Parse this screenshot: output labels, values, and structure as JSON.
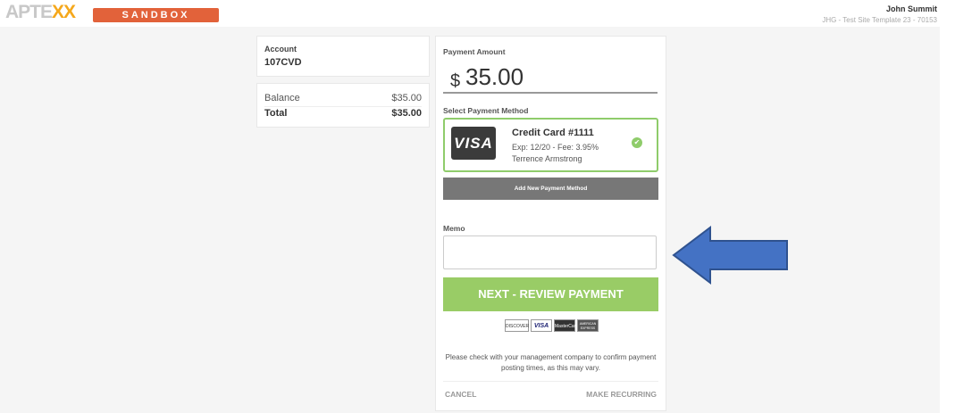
{
  "brand": {
    "logo_main": "APTE",
    "logo_accent": "XX",
    "env_badge": "SANDBOX"
  },
  "user": {
    "name": "John Summit",
    "site": "JHG - Test Site Template 23 - 70153"
  },
  "account": {
    "label": "Account",
    "value": "107CVD"
  },
  "balance": {
    "rows": [
      {
        "label": "Balance",
        "amount": "$35.00"
      },
      {
        "label": "Total",
        "amount": "$35.00"
      }
    ]
  },
  "payment": {
    "amount_label": "Payment Amount",
    "currency_symbol": "$",
    "amount": "35.00",
    "method_label": "Select Payment Method",
    "card": {
      "brand": "VISA",
      "title": "Credit Card #1111",
      "exp_fee": "Exp: 12/20 - Fee: 3.95%",
      "holder": "Terrence Armstrong"
    },
    "add_method_label": "Add New Payment Method",
    "memo_label": "Memo",
    "memo_value": "",
    "next_label": "NEXT - REVIEW PAYMENT",
    "accepted_cards": [
      "DISCOVER",
      "VISA",
      "MasterCard",
      "AMERICAN EXPRESS"
    ],
    "notice": "Please check with your management company to confirm payment posting times, as this may vary.",
    "cancel_label": "CANCEL",
    "recurring_label": "MAKE RECURRING"
  },
  "colors": {
    "sandbox": "#e2623a",
    "accent": "#f5a81c",
    "success": "#8fcc6b",
    "next_button": "#99cc66",
    "arrow": "#4472c4"
  }
}
